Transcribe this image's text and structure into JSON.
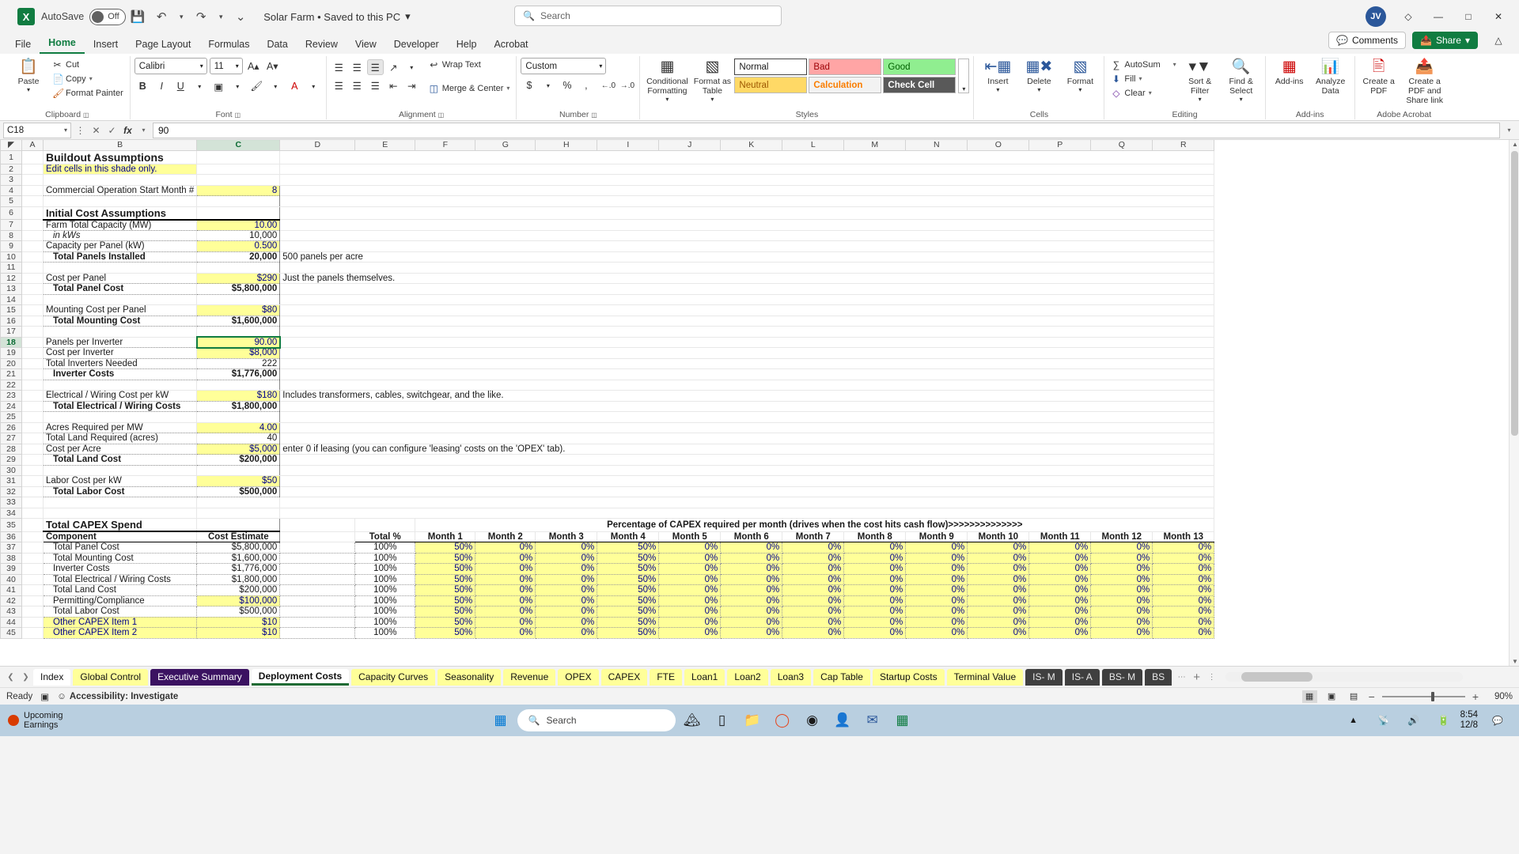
{
  "titlebar": {
    "autosave_label": "AutoSave",
    "toggle_state": "Off",
    "document_title": "Solar Farm • Saved to this PC",
    "search_placeholder": "Search",
    "avatar_initials": "JV",
    "icons": {
      "save": "save-icon",
      "undo": "undo-icon",
      "redo": "redo-icon",
      "customize": "customize-quick-access-icon"
    }
  },
  "menu": {
    "items": [
      "File",
      "Home",
      "Insert",
      "Page Layout",
      "Formulas",
      "Data",
      "Review",
      "View",
      "Developer",
      "Help",
      "Acrobat"
    ],
    "active": "Home",
    "comments_label": "Comments",
    "share_label": "Share"
  },
  "ribbon": {
    "clipboard": {
      "group": "Clipboard",
      "paste": "Paste",
      "cut": "Cut",
      "copy": "Copy",
      "format_painter": "Format Painter"
    },
    "font": {
      "group": "Font",
      "family": "Calibri",
      "size": "11",
      "grow": "A",
      "shrink": "A",
      "bold": "B",
      "italic": "I",
      "underline": "U"
    },
    "alignment": {
      "group": "Alignment",
      "wrap_text": "Wrap Text",
      "merge_center": "Merge & Center"
    },
    "number": {
      "group": "Number",
      "format": "Custom"
    },
    "styles": {
      "group": "Styles",
      "conditional_formatting": "Conditional Formatting",
      "format_as_table": "Format as Table",
      "cells": [
        "Normal",
        "Bad",
        "Good",
        "Neutral",
        "Calculation",
        "Check Cell"
      ]
    },
    "cells": {
      "group": "Cells",
      "insert": "Insert",
      "delete": "Delete",
      "format": "Format"
    },
    "editing": {
      "group": "Editing",
      "autosum": "AutoSum",
      "fill": "Fill",
      "clear": "Clear",
      "sort_filter": "Sort & Filter",
      "find_select": "Find & Select"
    },
    "addins": {
      "group": "Add-ins",
      "add_ins": "Add-ins",
      "analyze_data": "Analyze Data"
    },
    "acrobat": {
      "group": "Adobe Acrobat",
      "create_pdf": "Create a PDF",
      "create_share": "Create a PDF and Share link"
    }
  },
  "formula_bar": {
    "name_box": "C18",
    "formula": "90",
    "cancel": "cancel-icon",
    "enter": "enter-icon",
    "fx": "fx"
  },
  "grid": {
    "columns": [
      "A",
      "B",
      "C",
      "D",
      "E",
      "F",
      "G",
      "H",
      "I",
      "J",
      "K",
      "L",
      "M",
      "N",
      "O",
      "P",
      "Q",
      "R"
    ],
    "selected_cell": "C18",
    "rows": [
      {
        "n": 1,
        "b": "Buildout Assumptions",
        "style": "title"
      },
      {
        "n": 2,
        "b": "Edit cells in this shade only.",
        "style": "note"
      },
      {
        "n": 3
      },
      {
        "n": 4,
        "b": "Commercial Operation Start Month #",
        "c": "8",
        "input": true,
        "style": "underline"
      },
      {
        "n": 5
      },
      {
        "n": 6,
        "b": "Initial Cost Assumptions",
        "style": "section"
      },
      {
        "n": 7,
        "b": "Farm Total Capacity (MW)",
        "c": "10.00",
        "input": true
      },
      {
        "n": 8,
        "b": "in kWs",
        "c": "10,000",
        "indent": true,
        "italic": true
      },
      {
        "n": 9,
        "b": "Capacity per Panel (kW)",
        "c": "0.500",
        "input": true
      },
      {
        "n": 10,
        "b": "Total Panels Installed",
        "c": "20,000",
        "bold": true,
        "indent": true,
        "d": "500 panels per acre"
      },
      {
        "n": 11
      },
      {
        "n": 12,
        "b": "Cost per Panel",
        "c": "$290",
        "input": true,
        "d": "Just the panels themselves."
      },
      {
        "n": 13,
        "b": "Total Panel Cost",
        "c": "$5,800,000",
        "bold": true,
        "indent": true
      },
      {
        "n": 14
      },
      {
        "n": 15,
        "b": "Mounting Cost per Panel",
        "c": "$80",
        "input": true
      },
      {
        "n": 16,
        "b": "Total Mounting Cost",
        "c": "$1,600,000",
        "bold": true,
        "indent": true
      },
      {
        "n": 17
      },
      {
        "n": 18,
        "b": "Panels per Inverter",
        "c": "90.00",
        "input": true,
        "selected": true
      },
      {
        "n": 19,
        "b": "Cost per Inverter",
        "c": "$8,000",
        "input": true
      },
      {
        "n": 20,
        "b": "Total Inverters Needed",
        "c": "222"
      },
      {
        "n": 21,
        "b": "Inverter Costs",
        "c": "$1,776,000",
        "bold": true,
        "indent": true
      },
      {
        "n": 22
      },
      {
        "n": 23,
        "b": "Electrical / Wiring Cost per kW",
        "c": "$180",
        "input": true,
        "d": "Includes transformers, cables, switchgear, and the like."
      },
      {
        "n": 24,
        "b": "Total Electrical / Wiring Costs",
        "c": "$1,800,000",
        "bold": true,
        "indent": true
      },
      {
        "n": 25
      },
      {
        "n": 26,
        "b": "Acres Required per MW",
        "c": "4.00",
        "input": true
      },
      {
        "n": 27,
        "b": "Total Land Required (acres)",
        "c": "40"
      },
      {
        "n": 28,
        "b": "Cost per Acre",
        "c": "$5,000",
        "input": true,
        "d": "enter 0 if leasing (you can configure 'leasing' costs on the 'OPEX' tab)."
      },
      {
        "n": 29,
        "b": "Total Land Cost",
        "c": "$200,000",
        "bold": true,
        "indent": true
      },
      {
        "n": 30
      },
      {
        "n": 31,
        "b": "Labor Cost per kW",
        "c": "$50",
        "input": true
      },
      {
        "n": 32,
        "b": "Total Labor Cost",
        "c": "$500,000",
        "bold": true,
        "indent": true
      },
      {
        "n": 33
      },
      {
        "n": 34
      },
      {
        "n": 35,
        "b": "Total CAPEX Spend",
        "style": "section"
      },
      {
        "n": 36,
        "header": true
      }
    ]
  },
  "capex_table": {
    "section_title": "Total CAPEX Spend",
    "banner": "Percentage of CAPEX required per month (drives when the cost hits cash flow)>>>>>>>>>>>>>>",
    "headers": {
      "component": "Component",
      "cost_estimate": "Cost Estimate",
      "total_pct": "Total %"
    },
    "month_headers": [
      "Month 1",
      "Month 2",
      "Month 3",
      "Month 4",
      "Month 5",
      "Month 6",
      "Month 7",
      "Month 8",
      "Month 9",
      "Month 10",
      "Month 11",
      "Month 12",
      "Month 13"
    ],
    "rows": [
      {
        "row": 37,
        "component": "Total Panel Cost",
        "cost": "$5,800,000",
        "cost_input": false,
        "total": "100%",
        "months": [
          "50%",
          "0%",
          "0%",
          "50%",
          "0%",
          "0%",
          "0%",
          "0%",
          "0%",
          "0%",
          "0%",
          "0%",
          "0%"
        ]
      },
      {
        "row": 38,
        "component": "Total Mounting Cost",
        "cost": "$1,600,000",
        "cost_input": false,
        "total": "100%",
        "months": [
          "50%",
          "0%",
          "0%",
          "50%",
          "0%",
          "0%",
          "0%",
          "0%",
          "0%",
          "0%",
          "0%",
          "0%",
          "0%"
        ]
      },
      {
        "row": 39,
        "component": "Inverter Costs",
        "cost": "$1,776,000",
        "cost_input": false,
        "total": "100%",
        "months": [
          "50%",
          "0%",
          "0%",
          "50%",
          "0%",
          "0%",
          "0%",
          "0%",
          "0%",
          "0%",
          "0%",
          "0%",
          "0%"
        ]
      },
      {
        "row": 40,
        "component": "Total Electrical / Wiring Costs",
        "cost": "$1,800,000",
        "cost_input": false,
        "total": "100%",
        "months": [
          "50%",
          "0%",
          "0%",
          "50%",
          "0%",
          "0%",
          "0%",
          "0%",
          "0%",
          "0%",
          "0%",
          "0%",
          "0%"
        ]
      },
      {
        "row": 41,
        "component": "Total Land Cost",
        "cost": "$200,000",
        "cost_input": false,
        "total": "100%",
        "months": [
          "50%",
          "0%",
          "0%",
          "50%",
          "0%",
          "0%",
          "0%",
          "0%",
          "0%",
          "0%",
          "0%",
          "0%",
          "0%"
        ]
      },
      {
        "row": 42,
        "component": "Permitting/Compliance",
        "cost": "$100,000",
        "cost_input": true,
        "total": "100%",
        "months": [
          "50%",
          "0%",
          "0%",
          "50%",
          "0%",
          "0%",
          "0%",
          "0%",
          "0%",
          "0%",
          "0%",
          "0%",
          "0%"
        ]
      },
      {
        "row": 43,
        "component": "Total Labor Cost",
        "cost": "$500,000",
        "cost_input": false,
        "total": "100%",
        "months": [
          "50%",
          "0%",
          "0%",
          "50%",
          "0%",
          "0%",
          "0%",
          "0%",
          "0%",
          "0%",
          "0%",
          "0%",
          "0%"
        ]
      },
      {
        "row": 44,
        "component": "Other CAPEX Item 1",
        "cost": "$10",
        "cost_input": true,
        "name_input": true,
        "total": "100%",
        "months": [
          "50%",
          "0%",
          "0%",
          "50%",
          "0%",
          "0%",
          "0%",
          "0%",
          "0%",
          "0%",
          "0%",
          "0%",
          "0%"
        ]
      },
      {
        "row": 45,
        "component": "Other CAPEX Item 2",
        "cost": "$10",
        "cost_input": true,
        "name_input": true,
        "total": "100%",
        "months": [
          "50%",
          "0%",
          "0%",
          "50%",
          "0%",
          "0%",
          "0%",
          "0%",
          "0%",
          "0%",
          "0%",
          "0%",
          "0%"
        ]
      }
    ]
  },
  "sheet_tabs": {
    "items": [
      {
        "label": "Index",
        "color": "white"
      },
      {
        "label": "Global Control",
        "color": "yel"
      },
      {
        "label": "Executive Summary",
        "color": "purple"
      },
      {
        "label": "Deployment Costs",
        "color": "active"
      },
      {
        "label": "Capacity Curves",
        "color": "yel"
      },
      {
        "label": "Seasonality",
        "color": "yel"
      },
      {
        "label": "Revenue",
        "color": "yel"
      },
      {
        "label": "OPEX",
        "color": "yel"
      },
      {
        "label": "CAPEX",
        "color": "yel"
      },
      {
        "label": "FTE",
        "color": "yel"
      },
      {
        "label": "Loan1",
        "color": "yel"
      },
      {
        "label": "Loan2",
        "color": "yel"
      },
      {
        "label": "Loan3",
        "color": "yel"
      },
      {
        "label": "Cap Table",
        "color": "yel"
      },
      {
        "label": "Startup Costs",
        "color": "yel"
      },
      {
        "label": "Terminal Value",
        "color": "yel"
      },
      {
        "label": "IS- M",
        "color": "dark"
      },
      {
        "label": "IS- A",
        "color": "dark"
      },
      {
        "label": "BS- M",
        "color": "dark"
      },
      {
        "label": "BS",
        "color": "dark"
      }
    ],
    "more_label": "…",
    "add_label": "+"
  },
  "status_bar": {
    "ready": "Ready",
    "accessibility": "Accessibility: Investigate",
    "zoom": "90%"
  },
  "taskbar": {
    "upcoming_line1": "Upcoming",
    "upcoming_line2": "Earnings",
    "search_placeholder": "Search",
    "time": "8:54",
    "date": "12/8"
  }
}
